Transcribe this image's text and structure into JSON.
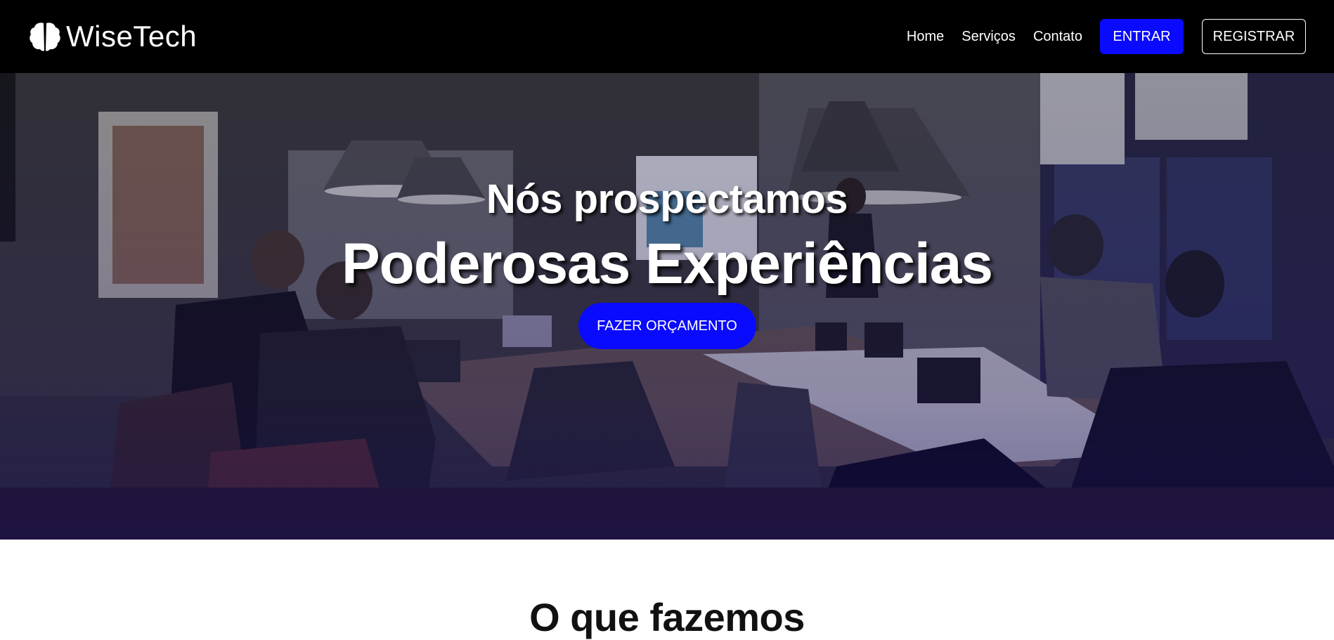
{
  "nav": {
    "brand": "WiseTech",
    "logo_icon": "brain-icon",
    "links": [
      "Home",
      "Serviços",
      "Contato"
    ],
    "login_label": "ENTRAR",
    "register_label": "REGISTRAR"
  },
  "hero": {
    "subtitle": "Nós prospectamos",
    "title": "Poderosas Experiências",
    "cta_label": "FAZER ORÇAMENTO"
  },
  "section": {
    "title": "O que fazemos"
  },
  "colors": {
    "accent": "#0a0aff",
    "navbar": "#000000",
    "background": "#ffffff"
  }
}
